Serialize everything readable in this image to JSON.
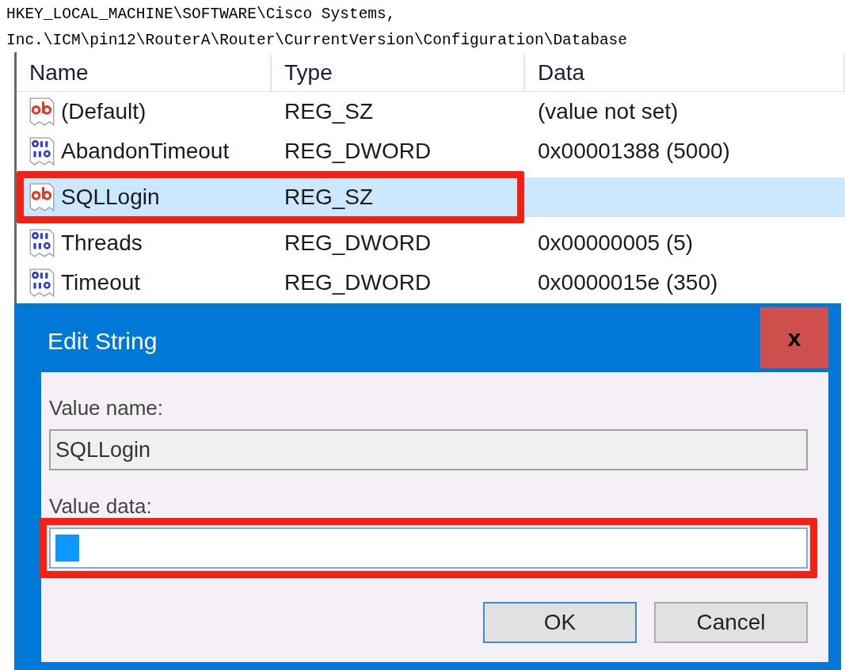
{
  "path": "HKEY_LOCAL_MACHINE\\SOFTWARE\\Cisco Systems, Inc.\\ICM\\pin12\\RouterA\\Router\\CurrentVersion\\Configuration\\Database",
  "table": {
    "columns": [
      "Name",
      "Type",
      "Data"
    ],
    "rows": [
      {
        "kind": "string",
        "name": "(Default)",
        "type": "REG_SZ",
        "data": "(value not set)",
        "selected": false,
        "highlighted": false
      },
      {
        "kind": "binary",
        "name": "AbandonTimeout",
        "type": "REG_DWORD",
        "data": "0x00001388 (5000)",
        "selected": false,
        "highlighted": false
      },
      {
        "kind": "string",
        "name": "SQLLogin",
        "type": "REG_SZ",
        "selected": true,
        "highlighted": true
      },
      {
        "kind": "binary",
        "name": "Threads",
        "type": "REG_DWORD",
        "data": "0x00000005 (5)",
        "selected": false,
        "highlighted": false
      },
      {
        "kind": "binary",
        "name": "Timeout",
        "type": "REG_DWORD",
        "data": "0x0000015e (350)",
        "selected": false,
        "highlighted": false
      }
    ]
  },
  "dialog": {
    "title": "Edit String",
    "close": "x",
    "fields": [
      {
        "label": "Value name:",
        "value": "SQLLogin",
        "readonly": true,
        "focused": false,
        "highlighted": false
      },
      {
        "label": "Value data:",
        "readonly": false,
        "focused": true,
        "highlighted": true
      }
    ],
    "buttons": [
      {
        "label": "OK",
        "default": true
      },
      {
        "label": "Cancel",
        "default": false
      }
    ]
  }
}
